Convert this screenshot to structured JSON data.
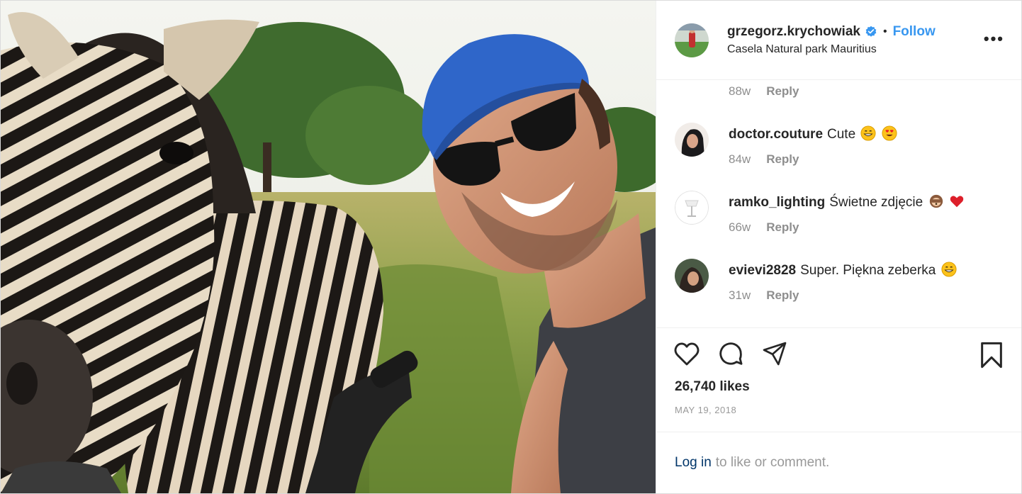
{
  "post": {
    "username": "grzegorz.krychowiak",
    "follow_label": "Follow",
    "separator": "•",
    "location": "Casela Natural park Mauritius",
    "more_label": "•••",
    "photo_alt": "zebra-selfie-photo",
    "likes": "26,740 likes",
    "date": "MAY 19, 2018"
  },
  "comments": {
    "partial_top": {
      "age": "88w",
      "reply": "Reply"
    },
    "items": [
      {
        "user": "doctor.couture",
        "text": "Cute",
        "age": "84w",
        "reply": "Reply",
        "emojis": [
          "grin-emoji",
          "heart-eyes-emoji"
        ]
      },
      {
        "user": "ramko_lighting",
        "text": "Świetne zdjęcie",
        "age": "66w",
        "reply": "Reply",
        "emojis": [
          "monkey-emoji",
          "red-heart-emoji"
        ]
      },
      {
        "user": "evievi2828",
        "text": "Super. Piękna zeberka",
        "age": "31w",
        "reply": "Reply",
        "emojis": [
          "grin-emoji"
        ]
      }
    ]
  },
  "footer": {
    "login_link": "Log in",
    "login_suffix": "to like or comment."
  },
  "colors": {
    "accent": "#3897f0",
    "verified": "#3897f0",
    "text_muted": "#8e8e8e",
    "heart": "#ed4956"
  },
  "icons": [
    "verified-badge-icon",
    "more-options-icon",
    "heart-icon",
    "comment-icon",
    "share-icon",
    "bookmark-icon"
  ]
}
